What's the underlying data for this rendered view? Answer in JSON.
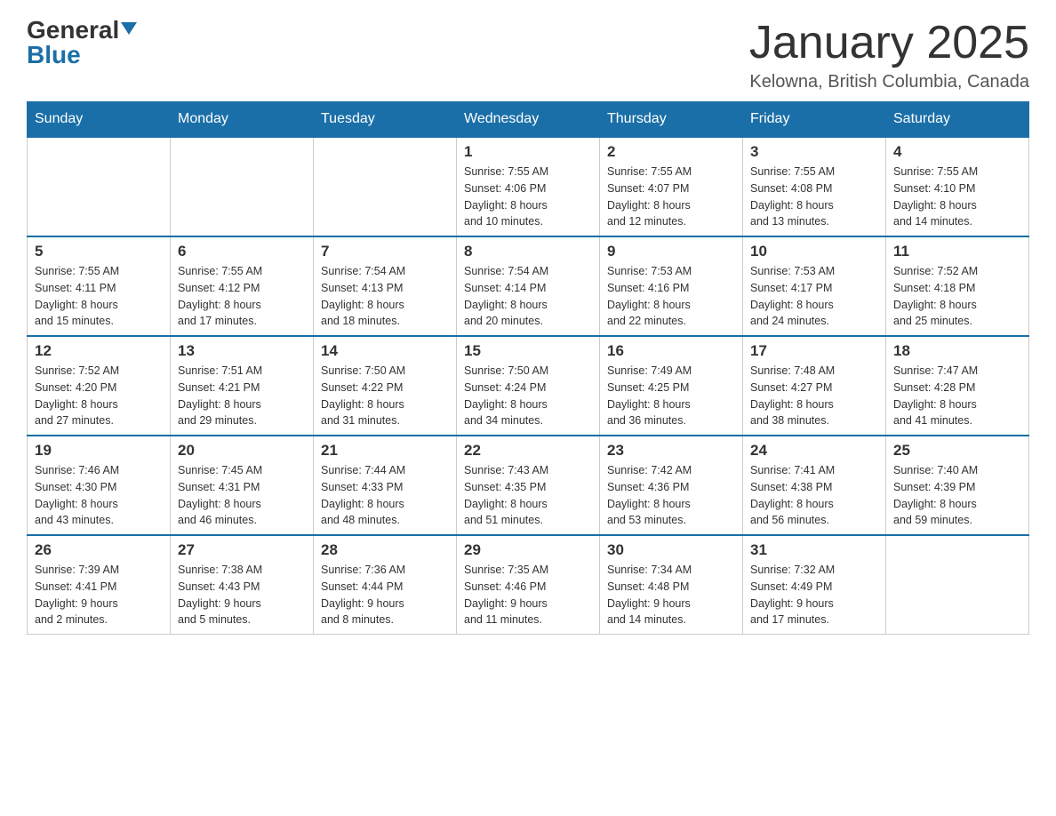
{
  "logo": {
    "text_general": "General",
    "text_blue": "Blue"
  },
  "title": "January 2025",
  "location": "Kelowna, British Columbia, Canada",
  "days_of_week": [
    "Sunday",
    "Monday",
    "Tuesday",
    "Wednesday",
    "Thursday",
    "Friday",
    "Saturday"
  ],
  "weeks": [
    [
      {
        "day": "",
        "info": ""
      },
      {
        "day": "",
        "info": ""
      },
      {
        "day": "",
        "info": ""
      },
      {
        "day": "1",
        "info": "Sunrise: 7:55 AM\nSunset: 4:06 PM\nDaylight: 8 hours\nand 10 minutes."
      },
      {
        "day": "2",
        "info": "Sunrise: 7:55 AM\nSunset: 4:07 PM\nDaylight: 8 hours\nand 12 minutes."
      },
      {
        "day": "3",
        "info": "Sunrise: 7:55 AM\nSunset: 4:08 PM\nDaylight: 8 hours\nand 13 minutes."
      },
      {
        "day": "4",
        "info": "Sunrise: 7:55 AM\nSunset: 4:10 PM\nDaylight: 8 hours\nand 14 minutes."
      }
    ],
    [
      {
        "day": "5",
        "info": "Sunrise: 7:55 AM\nSunset: 4:11 PM\nDaylight: 8 hours\nand 15 minutes."
      },
      {
        "day": "6",
        "info": "Sunrise: 7:55 AM\nSunset: 4:12 PM\nDaylight: 8 hours\nand 17 minutes."
      },
      {
        "day": "7",
        "info": "Sunrise: 7:54 AM\nSunset: 4:13 PM\nDaylight: 8 hours\nand 18 minutes."
      },
      {
        "day": "8",
        "info": "Sunrise: 7:54 AM\nSunset: 4:14 PM\nDaylight: 8 hours\nand 20 minutes."
      },
      {
        "day": "9",
        "info": "Sunrise: 7:53 AM\nSunset: 4:16 PM\nDaylight: 8 hours\nand 22 minutes."
      },
      {
        "day": "10",
        "info": "Sunrise: 7:53 AM\nSunset: 4:17 PM\nDaylight: 8 hours\nand 24 minutes."
      },
      {
        "day": "11",
        "info": "Sunrise: 7:52 AM\nSunset: 4:18 PM\nDaylight: 8 hours\nand 25 minutes."
      }
    ],
    [
      {
        "day": "12",
        "info": "Sunrise: 7:52 AM\nSunset: 4:20 PM\nDaylight: 8 hours\nand 27 minutes."
      },
      {
        "day": "13",
        "info": "Sunrise: 7:51 AM\nSunset: 4:21 PM\nDaylight: 8 hours\nand 29 minutes."
      },
      {
        "day": "14",
        "info": "Sunrise: 7:50 AM\nSunset: 4:22 PM\nDaylight: 8 hours\nand 31 minutes."
      },
      {
        "day": "15",
        "info": "Sunrise: 7:50 AM\nSunset: 4:24 PM\nDaylight: 8 hours\nand 34 minutes."
      },
      {
        "day": "16",
        "info": "Sunrise: 7:49 AM\nSunset: 4:25 PM\nDaylight: 8 hours\nand 36 minutes."
      },
      {
        "day": "17",
        "info": "Sunrise: 7:48 AM\nSunset: 4:27 PM\nDaylight: 8 hours\nand 38 minutes."
      },
      {
        "day": "18",
        "info": "Sunrise: 7:47 AM\nSunset: 4:28 PM\nDaylight: 8 hours\nand 41 minutes."
      }
    ],
    [
      {
        "day": "19",
        "info": "Sunrise: 7:46 AM\nSunset: 4:30 PM\nDaylight: 8 hours\nand 43 minutes."
      },
      {
        "day": "20",
        "info": "Sunrise: 7:45 AM\nSunset: 4:31 PM\nDaylight: 8 hours\nand 46 minutes."
      },
      {
        "day": "21",
        "info": "Sunrise: 7:44 AM\nSunset: 4:33 PM\nDaylight: 8 hours\nand 48 minutes."
      },
      {
        "day": "22",
        "info": "Sunrise: 7:43 AM\nSunset: 4:35 PM\nDaylight: 8 hours\nand 51 minutes."
      },
      {
        "day": "23",
        "info": "Sunrise: 7:42 AM\nSunset: 4:36 PM\nDaylight: 8 hours\nand 53 minutes."
      },
      {
        "day": "24",
        "info": "Sunrise: 7:41 AM\nSunset: 4:38 PM\nDaylight: 8 hours\nand 56 minutes."
      },
      {
        "day": "25",
        "info": "Sunrise: 7:40 AM\nSunset: 4:39 PM\nDaylight: 8 hours\nand 59 minutes."
      }
    ],
    [
      {
        "day": "26",
        "info": "Sunrise: 7:39 AM\nSunset: 4:41 PM\nDaylight: 9 hours\nand 2 minutes."
      },
      {
        "day": "27",
        "info": "Sunrise: 7:38 AM\nSunset: 4:43 PM\nDaylight: 9 hours\nand 5 minutes."
      },
      {
        "day": "28",
        "info": "Sunrise: 7:36 AM\nSunset: 4:44 PM\nDaylight: 9 hours\nand 8 minutes."
      },
      {
        "day": "29",
        "info": "Sunrise: 7:35 AM\nSunset: 4:46 PM\nDaylight: 9 hours\nand 11 minutes."
      },
      {
        "day": "30",
        "info": "Sunrise: 7:34 AM\nSunset: 4:48 PM\nDaylight: 9 hours\nand 14 minutes."
      },
      {
        "day": "31",
        "info": "Sunrise: 7:32 AM\nSunset: 4:49 PM\nDaylight: 9 hours\nand 17 minutes."
      },
      {
        "day": "",
        "info": ""
      }
    ]
  ]
}
